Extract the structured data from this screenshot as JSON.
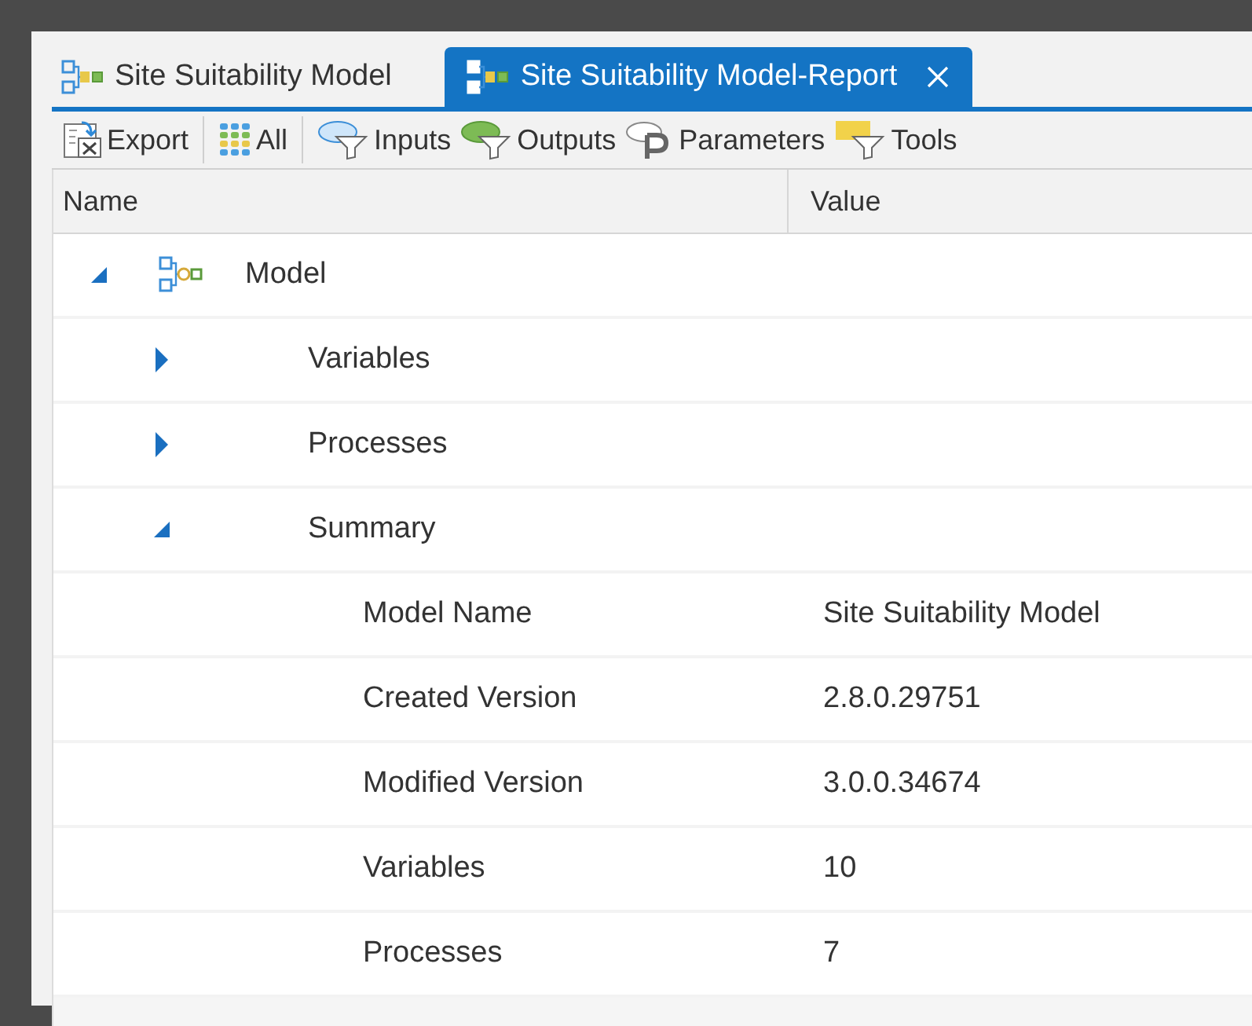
{
  "tabs": [
    {
      "label": "Site Suitability Model",
      "selected": false,
      "closable": false
    },
    {
      "label": "Site Suitability Model-Report",
      "selected": true,
      "closable": true
    }
  ],
  "toolbar": [
    {
      "label": "Export",
      "kind": "export"
    },
    {
      "label": "All",
      "kind": "all"
    },
    {
      "label": "Inputs",
      "kind": "inputs"
    },
    {
      "label": "Outputs",
      "kind": "outputs"
    },
    {
      "label": "Parameters",
      "kind": "parameters"
    },
    {
      "label": "Tools",
      "kind": "tools"
    }
  ],
  "table": {
    "columns": [
      "Name",
      "Value"
    ],
    "tree": [
      {
        "label": "Model",
        "expanded": true,
        "children": [
          {
            "label": "Variables",
            "expanded": false
          },
          {
            "label": "Processes",
            "expanded": false
          },
          {
            "label": "Summary",
            "expanded": true,
            "children": [
              {
                "label": "Model Name",
                "value": "Site Suitability Model"
              },
              {
                "label": "Created Version",
                "value": "2.8.0.29751"
              },
              {
                "label": "Modified Version",
                "value": "3.0.0.34674"
              },
              {
                "label": "Variables",
                "value": "10"
              },
              {
                "label": "Processes",
                "value": "7"
              }
            ]
          }
        ]
      }
    ]
  }
}
